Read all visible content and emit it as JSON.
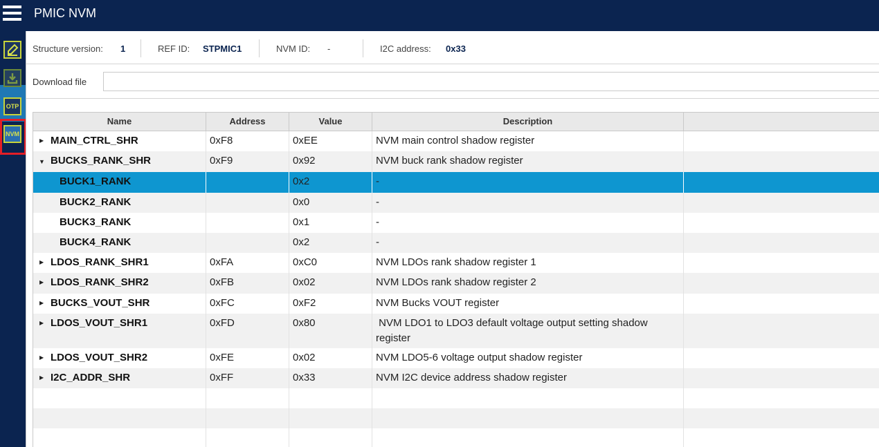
{
  "app": {
    "title": "PMIC NVM"
  },
  "sidebar": {
    "items": [
      {
        "name": "edit",
        "icon": "edit-icon"
      },
      {
        "name": "download",
        "icon": "download-icon"
      },
      {
        "name": "otp",
        "label": "OTP"
      },
      {
        "name": "nvm",
        "label": "NVM",
        "active": true
      }
    ]
  },
  "info": {
    "structure_version_label": "Structure version:",
    "structure_version": "1",
    "ref_id_label": "REF ID:",
    "ref_id": "STPMIC1",
    "nvm_id_label": "NVM ID:",
    "nvm_id": "-",
    "i2c_label": "I2C address:",
    "i2c": "0x33"
  },
  "download": {
    "label": "Download file",
    "value": ""
  },
  "table": {
    "headers": {
      "name": "Name",
      "address": "Address",
      "value": "Value",
      "description": "Description"
    },
    "rows": [
      {
        "name": "MAIN_CTRL_SHR",
        "address": "0xF8",
        "value": "0xEE",
        "description": "NVM main control shadow register",
        "expander": "▶"
      },
      {
        "name": "BUCKS_RANK_SHR",
        "address": "0xF9",
        "value": "0x92",
        "description": "NVM buck rank shadow register",
        "expander": "▼"
      },
      {
        "name": "BUCK1_RANK",
        "address": "",
        "value": "0x2",
        "description": "-",
        "expander": ""
      },
      {
        "name": "BUCK2_RANK",
        "address": "",
        "value": "0x0",
        "description": "-",
        "expander": ""
      },
      {
        "name": "BUCK3_RANK",
        "address": "",
        "value": "0x1",
        "description": "-",
        "expander": ""
      },
      {
        "name": "BUCK4_RANK",
        "address": "",
        "value": "0x2",
        "description": "-",
        "expander": ""
      },
      {
        "name": "LDOS_RANK_SHR1",
        "address": "0xFA",
        "value": "0xC0",
        "description": "NVM LDOs rank shadow register 1",
        "expander": "▶"
      },
      {
        "name": "LDOS_RANK_SHR2",
        "address": "0xFB",
        "value": "0x02",
        "description": "NVM LDOs rank shadow register 2",
        "expander": "▶"
      },
      {
        "name": "BUCKS_VOUT_SHR",
        "address": "0xFC",
        "value": "0xF2",
        "description": "NVM Bucks VOUT register",
        "expander": "▶"
      },
      {
        "name": "LDOS_VOUT_SHR1",
        "address": "0xFD",
        "value": "0x80",
        "description": " NVM LDO1 to LDO3 default voltage output setting shadow register",
        "expander": "▶"
      },
      {
        "name": "LDOS_VOUT_SHR2",
        "address": "0xFE",
        "value": "0x02",
        "description": "NVM LDO5-6 voltage output shadow register",
        "expander": "▶"
      },
      {
        "name": "I2C_ADDR_SHR",
        "address": "0xFF",
        "value": "0x33",
        "description": "NVM I2C device address shadow register",
        "expander": "▶"
      }
    ]
  },
  "colors": {
    "navy": "#0b2450",
    "selection": "#0e96d0",
    "highlight": "#e41e26",
    "accent": "#c8d43a"
  }
}
